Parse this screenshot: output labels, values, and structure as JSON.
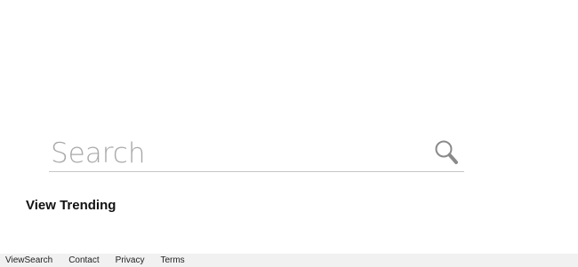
{
  "search": {
    "placeholder": "Search",
    "value": "",
    "icon": "magnifier-icon"
  },
  "trending": {
    "label": "View Trending"
  },
  "footer": {
    "links": [
      {
        "label": "ViewSearch"
      },
      {
        "label": "Contact"
      },
      {
        "label": "Privacy"
      },
      {
        "label": "Terms"
      }
    ]
  },
  "colors": {
    "background": "#ffffff",
    "footer_background": "#f1f1f1",
    "placeholder": "#a8a8a8",
    "underline": "#c6c6c6",
    "icon": "#8a8a8a"
  }
}
